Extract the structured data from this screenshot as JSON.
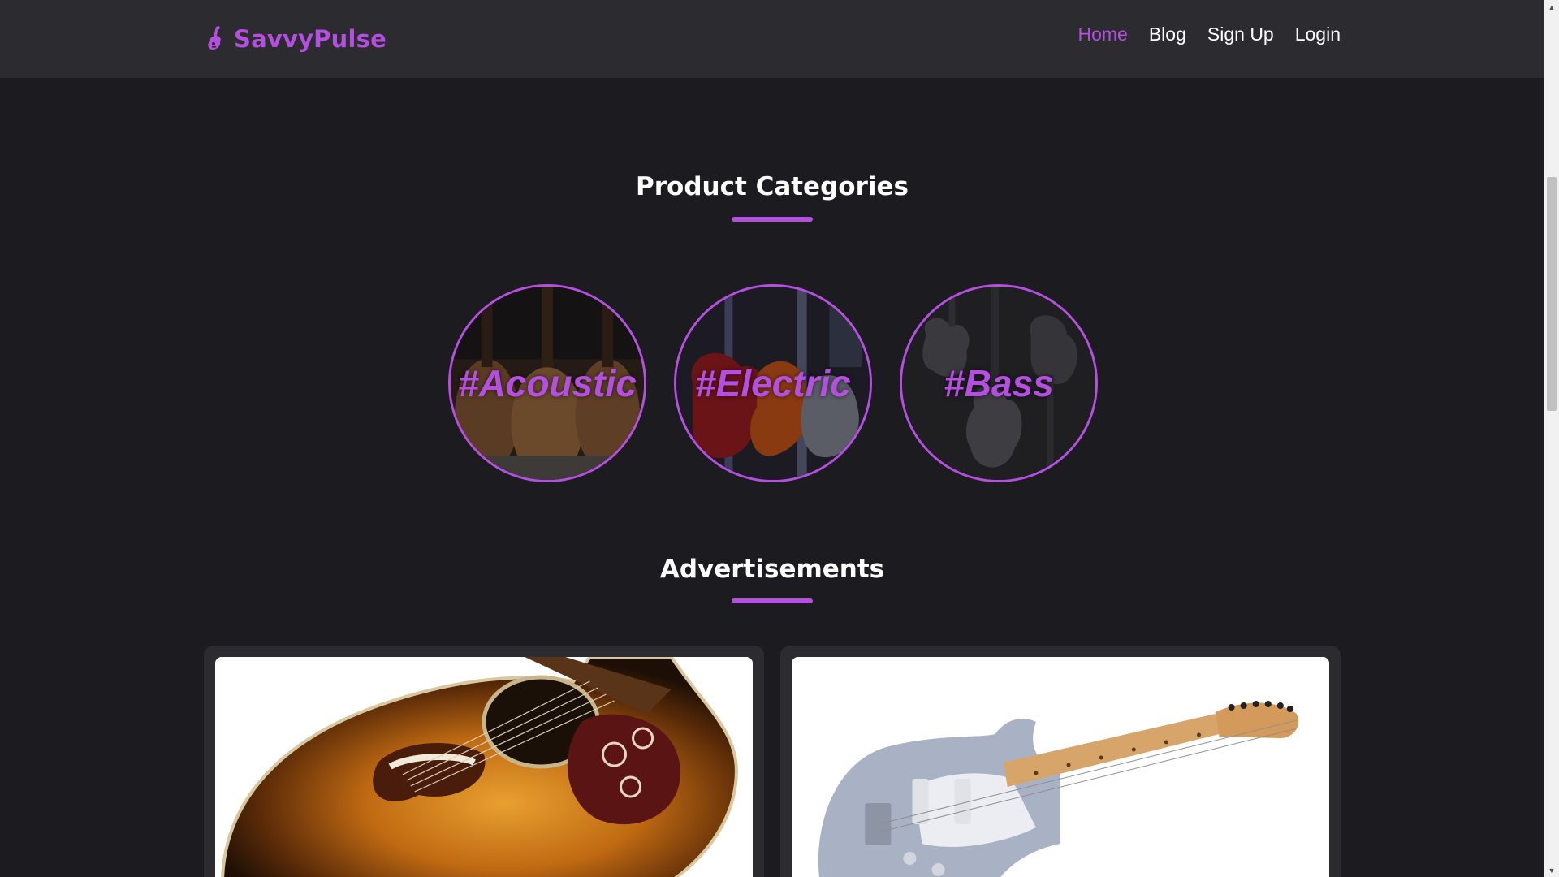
{
  "theme": {
    "accent": "#b44fe0"
  },
  "brand": {
    "name": "SavvyPulse",
    "icon": "guitar-icon"
  },
  "nav": {
    "items": [
      {
        "label": "Home",
        "active": true
      },
      {
        "label": "Blog",
        "active": false
      },
      {
        "label": "Sign Up",
        "active": false
      },
      {
        "label": "Login",
        "active": false
      }
    ]
  },
  "categories_section": {
    "title": "Product Categories",
    "items": [
      {
        "label": "#Acoustic"
      },
      {
        "label": "#Electric"
      },
      {
        "label": "#Bass"
      }
    ]
  },
  "ads_section": {
    "title": "Advertisements",
    "items": [
      {
        "image": "sunburst acoustic guitar"
      },
      {
        "image": "silver electric guitar"
      }
    ]
  }
}
